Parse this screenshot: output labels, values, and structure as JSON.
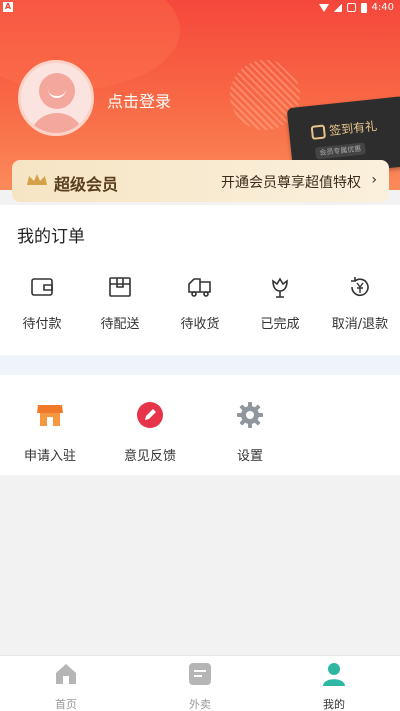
{
  "statusbar": {
    "time": "4:40",
    "left_badge": "A"
  },
  "profile": {
    "login_text": "点击登录"
  },
  "gift_card": {
    "title": "签到有礼",
    "subtitle": "会员专属优惠"
  },
  "vip": {
    "title": "超级会员",
    "promo": "开通会员尊享超值特权",
    "chevron": "›"
  },
  "orders": {
    "title": "我的订单",
    "items": [
      {
        "label": "待付款",
        "icon": "wallet-icon"
      },
      {
        "label": "待配送",
        "icon": "package-icon"
      },
      {
        "label": "待收货",
        "icon": "truck-icon"
      },
      {
        "label": "已完成",
        "icon": "flower-icon"
      },
      {
        "label": "取消/退款",
        "icon": "refund-icon"
      }
    ]
  },
  "tools": [
    {
      "label": "申请入驻",
      "icon": "store-icon"
    },
    {
      "label": "意见反馈",
      "icon": "pen-icon"
    },
    {
      "label": "设置",
      "icon": "gear-icon"
    }
  ],
  "bottom_nav": [
    {
      "label": "首页",
      "icon": "home-icon",
      "active": false
    },
    {
      "label": "外卖",
      "icon": "takeout-icon",
      "active": false
    },
    {
      "label": "我的",
      "icon": "user-icon",
      "active": true
    }
  ],
  "colors": {
    "primary": "#f5473c",
    "active_tab": "#2fb7a4",
    "inactive_tab": "#999999"
  }
}
